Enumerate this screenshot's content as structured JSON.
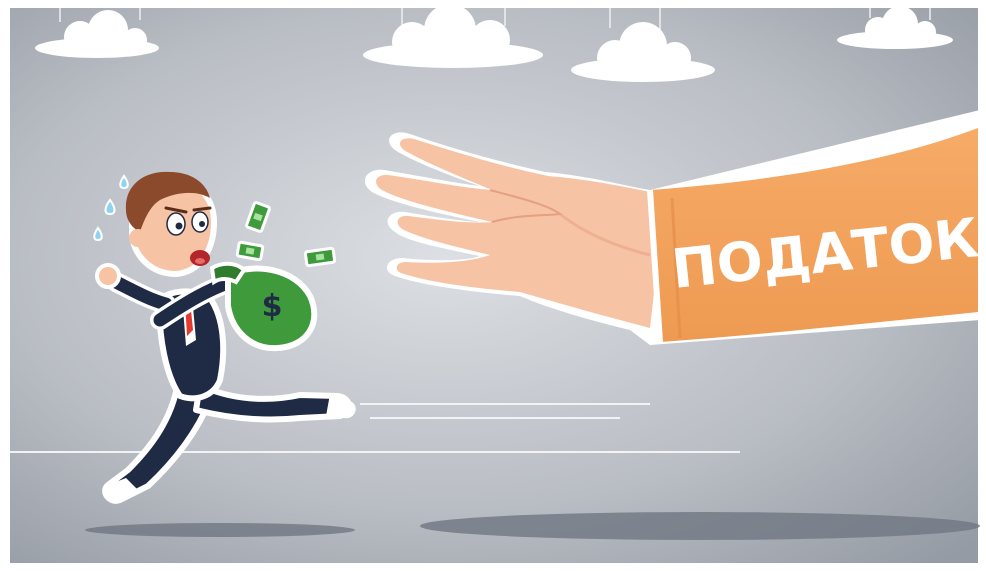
{
  "illustration": {
    "sleeve_text": "ПОДАТОК",
    "bag_symbol": "$",
    "colors": {
      "background_light": "#d8dbe0",
      "background_dark": "#9aa0a9",
      "sleeve": "#f4a15d",
      "sleeve_dark": "#e8904a",
      "skin": "#f7c3a5",
      "skin_shadow": "#eba888",
      "suit": "#1f2a44",
      "money_bag": "#3e9a3a",
      "hair": "#8b4a2b",
      "tie": "#e23a2e",
      "cloud": "#ffffff",
      "shadow": "#6f7782"
    },
    "icons": [
      "cloud-icon",
      "money-bag-icon",
      "banknote-icon",
      "sweat-drop-icon"
    ]
  }
}
